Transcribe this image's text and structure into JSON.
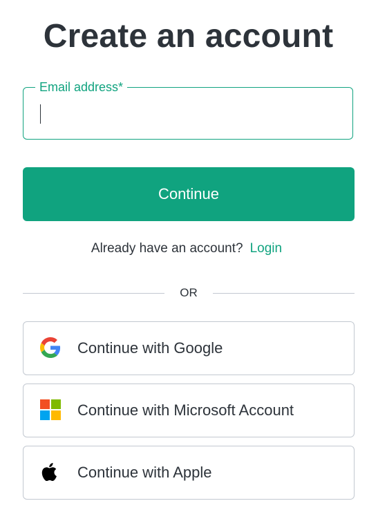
{
  "heading": "Create an account",
  "email_field": {
    "label": "Email address*",
    "value": "",
    "placeholder": ""
  },
  "continue_label": "Continue",
  "login_prompt": {
    "text": "Already have an account?",
    "link": "Login"
  },
  "divider_text": "OR",
  "social": [
    {
      "label": "Continue with Google",
      "icon": "google-icon"
    },
    {
      "label": "Continue with Microsoft Account",
      "icon": "microsoft-icon"
    },
    {
      "label": "Continue with Apple",
      "icon": "apple-icon"
    }
  ],
  "colors": {
    "accent": "#10a37f",
    "text": "#2d333a",
    "border": "#c2c8d0"
  }
}
